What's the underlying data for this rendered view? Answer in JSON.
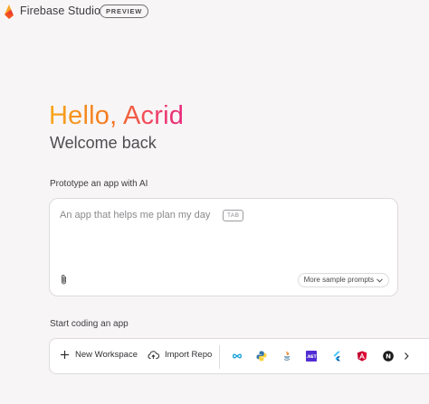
{
  "header": {
    "app_title": "Firebase Studio",
    "badge": "PREVIEW"
  },
  "hero": {
    "greeting": "Hello, Acrid",
    "subtitle": "Welcome back"
  },
  "prototype": {
    "section_label": "Prototype an app with AI",
    "placeholder": "An app that helps me plan my day",
    "tab_hint": "TAB",
    "samples_label": "More sample prompts"
  },
  "coding": {
    "section_label": "Start coding an app",
    "new_workspace_label": "New Workspace",
    "import_repo_label": "Import Repo",
    "templates": [
      "infinity-icon",
      "python-icon",
      "java-icon",
      "dotnet-icon",
      "flutter-icon",
      "angular-icon",
      "nextjs-icon"
    ],
    "template_text": {
      "dotnet": ".NET",
      "nextjs": "N"
    }
  },
  "colors": {
    "background": "#f8f5f6",
    "greeting_gradient": [
      "#f7a71a",
      "#f4781f",
      "#ef3f6b",
      "#e72879"
    ]
  }
}
